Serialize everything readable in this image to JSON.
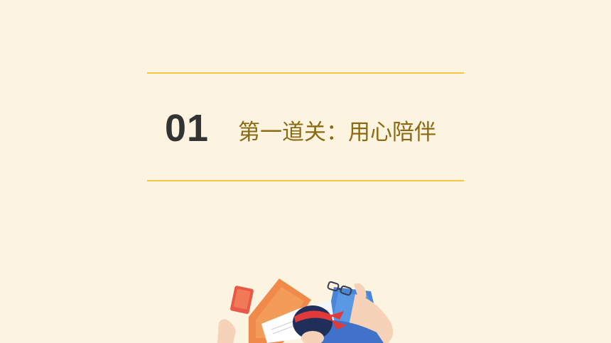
{
  "section": {
    "number": "01",
    "title": "第一道关：用心陪伴"
  },
  "colors": {
    "background": "#fcf4e0",
    "rule": "#f5c842",
    "number": "#333333",
    "title": "#8a6a12"
  },
  "illustration": {
    "subject": "student-asleep-on-books-illustration"
  }
}
